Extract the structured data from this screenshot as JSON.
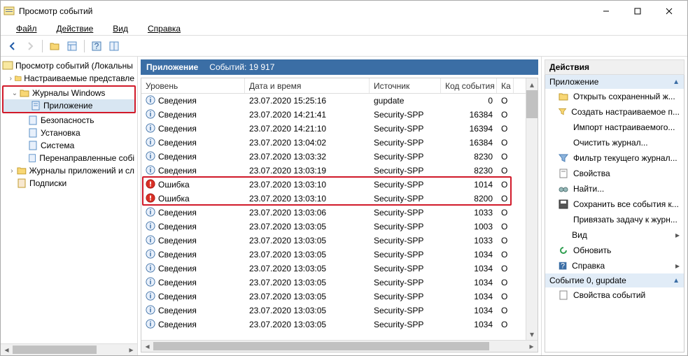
{
  "titlebar": {
    "title": "Просмотр событий"
  },
  "menu": {
    "file": "Файл",
    "action": "Действие",
    "view": "Вид",
    "help": "Справка"
  },
  "tree": {
    "root": "Просмотр событий (Локальны",
    "custom": "Настраиваемые представле",
    "winlogs": "Журналы Windows",
    "application": "Приложение",
    "security": "Безопасность",
    "setup": "Установка",
    "system": "Система",
    "forwarded": "Перенаправленные собі",
    "applogs": "Журналы приложений и сл",
    "subs": "Подписки"
  },
  "center": {
    "title": "Приложение",
    "count_label": "Событий: 19 917",
    "columns": {
      "level": "Уровень",
      "date": "Дата и время",
      "source": "Источник",
      "event": "Код события",
      "cat": "Кa"
    },
    "levels": {
      "info": "Сведения",
      "error": "Ошибка"
    },
    "rows": [
      {
        "lvl": "info",
        "date": "23.07.2020 15:25:16",
        "src": "gupdate",
        "evt": "0",
        "cat": "О"
      },
      {
        "lvl": "info",
        "date": "23.07.2020 14:21:41",
        "src": "Security-SPP",
        "evt": "16384",
        "cat": "О"
      },
      {
        "lvl": "info",
        "date": "23.07.2020 14:21:10",
        "src": "Security-SPP",
        "evt": "16394",
        "cat": "О"
      },
      {
        "lvl": "info",
        "date": "23.07.2020 13:04:02",
        "src": "Security-SPP",
        "evt": "16384",
        "cat": "О"
      },
      {
        "lvl": "info",
        "date": "23.07.2020 13:03:32",
        "src": "Security-SPP",
        "evt": "8230",
        "cat": "О"
      },
      {
        "lvl": "info",
        "date": "23.07.2020 13:03:19",
        "src": "Security-SPP",
        "evt": "8230",
        "cat": "О"
      },
      {
        "lvl": "error",
        "date": "23.07.2020 13:03:10",
        "src": "Security-SPP",
        "evt": "1014",
        "cat": "О"
      },
      {
        "lvl": "error",
        "date": "23.07.2020 13:03:10",
        "src": "Security-SPP",
        "evt": "8200",
        "cat": "О"
      },
      {
        "lvl": "info",
        "date": "23.07.2020 13:03:06",
        "src": "Security-SPP",
        "evt": "1033",
        "cat": "О"
      },
      {
        "lvl": "info",
        "date": "23.07.2020 13:03:05",
        "src": "Security-SPP",
        "evt": "1003",
        "cat": "О"
      },
      {
        "lvl": "info",
        "date": "23.07.2020 13:03:05",
        "src": "Security-SPP",
        "evt": "1033",
        "cat": "О"
      },
      {
        "lvl": "info",
        "date": "23.07.2020 13:03:05",
        "src": "Security-SPP",
        "evt": "1034",
        "cat": "О"
      },
      {
        "lvl": "info",
        "date": "23.07.2020 13:03:05",
        "src": "Security-SPP",
        "evt": "1034",
        "cat": "О"
      },
      {
        "lvl": "info",
        "date": "23.07.2020 13:03:05",
        "src": "Security-SPP",
        "evt": "1034",
        "cat": "О"
      },
      {
        "lvl": "info",
        "date": "23.07.2020 13:03:05",
        "src": "Security-SPP",
        "evt": "1034",
        "cat": "О"
      },
      {
        "lvl": "info",
        "date": "23.07.2020 13:03:05",
        "src": "Security-SPP",
        "evt": "1034",
        "cat": "О"
      },
      {
        "lvl": "info",
        "date": "23.07.2020 13:03:05",
        "src": "Security-SPP",
        "evt": "1034",
        "cat": "О"
      }
    ]
  },
  "actions": {
    "title": "Действия",
    "group1": "Приложение",
    "open_saved": "Открыть сохраненный ж...",
    "create_view": "Создать настраиваемое п...",
    "import_view": "Импорт настраиваемого...",
    "clear_log": "Очистить журнал...",
    "filter": "Фильтр текущего журнал...",
    "properties": "Свойства",
    "find": "Найти...",
    "save_all": "Сохранить все события к...",
    "attach_task": "Привязать задачу к журн...",
    "view": "Вид",
    "refresh": "Обновить",
    "help": "Справка",
    "group2": "Событие 0, gupdate",
    "event_props": "Свойства событий"
  }
}
